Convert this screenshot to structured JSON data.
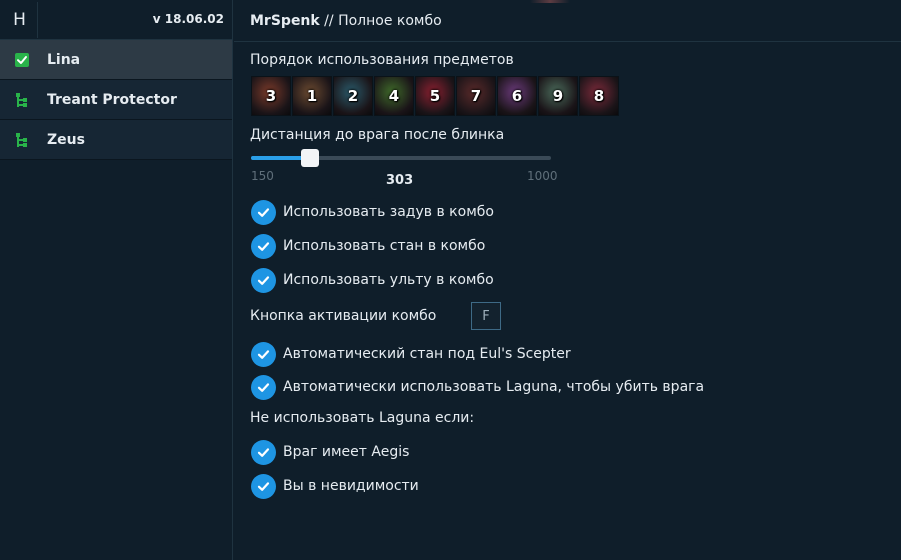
{
  "sidebar": {
    "logo": "H",
    "version": "v 18.06.02",
    "items": [
      {
        "label": "Lina",
        "icon": "green-check-icon",
        "active": true
      },
      {
        "label": "Treant Protector",
        "icon": "tree-icon",
        "active": false
      },
      {
        "label": "Zeus",
        "icon": "tree-icon",
        "active": false
      }
    ]
  },
  "header": {
    "author": "MrSpenk",
    "separator": " // ",
    "title": "Полное комбо"
  },
  "items_order": {
    "label": "Порядок использования предметов",
    "items": [
      {
        "number": "3",
        "color": "#7a3a2a"
      },
      {
        "number": "1",
        "color": "#6b4a30"
      },
      {
        "number": "2",
        "color": "#2a5a6a"
      },
      {
        "number": "4",
        "color": "#3f6a2a"
      },
      {
        "number": "5",
        "color": "#8a2030"
      },
      {
        "number": "7",
        "color": "#5a2a2a"
      },
      {
        "number": "6",
        "color": "#6a3a7a"
      },
      {
        "number": "9",
        "color": "#4a6a5a"
      },
      {
        "number": "8",
        "color": "#7a2a3a"
      }
    ]
  },
  "blink_distance": {
    "label": "Дистанция до врага после блинка",
    "min": "150",
    "max": "1000",
    "value": "303",
    "fraction": 0.18
  },
  "checks_1": [
    {
      "label": "Использовать задув в комбо",
      "checked": true
    },
    {
      "label": "Использовать стан в комбо",
      "checked": true
    },
    {
      "label": "Использовать ульту в комбо",
      "checked": true
    }
  ],
  "combo_key": {
    "label": "Кнопка активации комбо",
    "key": "F"
  },
  "checks_2": [
    {
      "label": "Автоматический стан под Eul's Scepter",
      "checked": true
    },
    {
      "label": "Автоматически использовать Laguna, чтобы убить врага",
      "checked": true
    }
  ],
  "laguna_conditions": {
    "label": "Не использовать Laguna если:",
    "items": [
      {
        "label": "Враг имеет Aegis",
        "checked": true
      },
      {
        "label": "Вы в невидимости",
        "checked": true
      }
    ]
  },
  "colors": {
    "accent": "#1e95e3",
    "background": "#0f1e2a",
    "sidebar_active": "#2d3a45",
    "sidebar_item": "#162634",
    "success": "#29b34a"
  }
}
